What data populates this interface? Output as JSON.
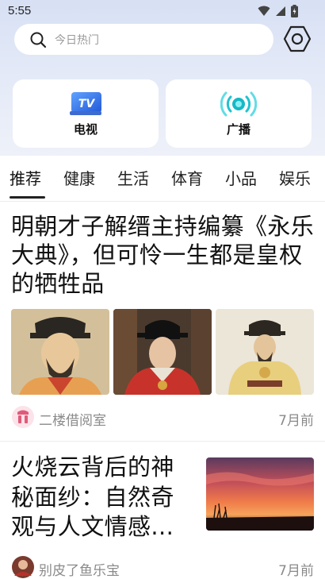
{
  "status_bar": {
    "time": "5:55"
  },
  "search": {
    "placeholder": "今日热门"
  },
  "cards": [
    {
      "label": "电视",
      "icon": "tv-icon",
      "badge": "TV"
    },
    {
      "label": "广播",
      "icon": "radio-broadcast-icon"
    }
  ],
  "tabs": [
    "推荐",
    "健康",
    "生活",
    "体育",
    "小品",
    "娱乐"
  ],
  "articles": [
    {
      "title": "明朝才子解缙主持编纂《永乐大典》，但可怜一生都是皇权的牺牲品",
      "source": "二楼借阅室",
      "time": "7月前"
    },
    {
      "title": "火烧云背后的神秘面纱：自然奇观与人文情感...",
      "source": "别皮了鱼乐宝",
      "time": "7月前"
    }
  ],
  "colors": {
    "accent": "#e05a7a",
    "top_gradient": "#d7e0f4",
    "tv_blue": "#3b7be6",
    "radio_teal": "#1bb5c4"
  }
}
